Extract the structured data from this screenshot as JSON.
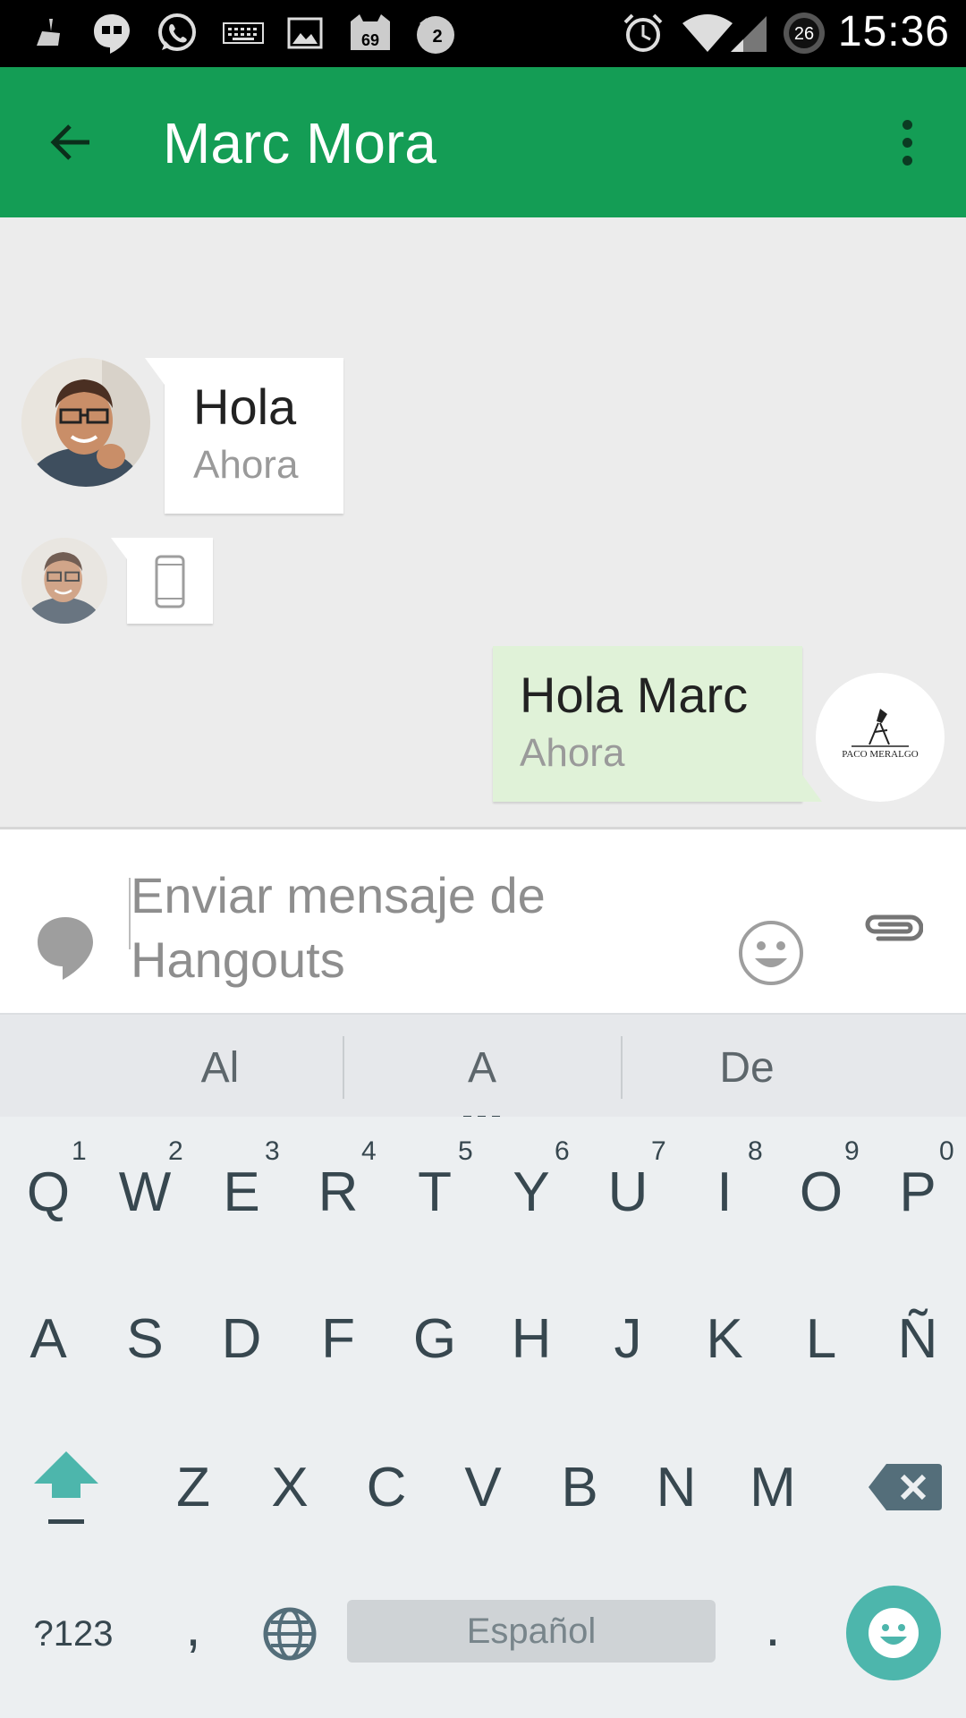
{
  "status_bar": {
    "time": "15:36",
    "battery_level": "26",
    "notification_badges": {
      "mail_count": "69",
      "chat_count": "2"
    }
  },
  "app_bar": {
    "title": "Marc Mora"
  },
  "messages": [
    {
      "text": "Hola",
      "time": "Ahora"
    },
    {
      "text": "Hola Marc",
      "time": "Ahora"
    }
  ],
  "sender_avatar_label": "PACO MERALGO",
  "compose": {
    "placeholder": "Enviar mensaje de Hangouts"
  },
  "suggestions": [
    "Al",
    "A",
    "De"
  ],
  "keyboard": {
    "row1": [
      "Q",
      "W",
      "E",
      "R",
      "T",
      "Y",
      "U",
      "I",
      "O",
      "P"
    ],
    "row1_hints": [
      "1",
      "2",
      "3",
      "4",
      "5",
      "6",
      "7",
      "8",
      "9",
      "0"
    ],
    "row2": [
      "A",
      "S",
      "D",
      "F",
      "G",
      "H",
      "J",
      "K",
      "L",
      "Ñ"
    ],
    "row3": [
      "Z",
      "X",
      "C",
      "V",
      "B",
      "N",
      "M"
    ],
    "symbols_label": "?123",
    "comma": ",",
    "period": ".",
    "space_label": "Español"
  },
  "colors": {
    "app_bar": "#149d55",
    "sent_bubble": "#e0f2d8",
    "emoji_fab": "#4db6ac",
    "shift_accent": "#4db6ac"
  },
  "icons": [
    "cleaner-icon",
    "hangouts-notification-icon",
    "whatsapp-icon",
    "keyboard-icon",
    "image-icon",
    "mail-icon",
    "chat-badge-icon",
    "alarm-icon",
    "wifi-icon",
    "signal-icon",
    "battery-icon",
    "back-arrow-icon",
    "overflow-menu-icon",
    "phone-device-icon",
    "hangouts-bubble-icon",
    "emoji-icon",
    "attach-icon",
    "shift-icon",
    "globe-icon",
    "backspace-icon"
  ]
}
